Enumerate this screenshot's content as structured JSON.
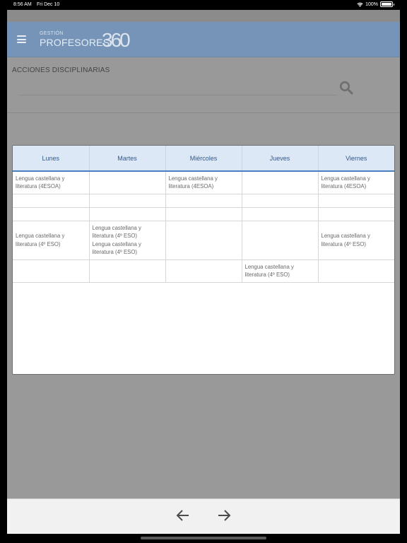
{
  "status_bar": {
    "time": "8:56 AM",
    "date": "Fri Dec 10",
    "battery": "100%",
    "battery_level": 1.0
  },
  "header": {
    "logo_small": "GESTIÓN",
    "logo_main": "PROFESORES",
    "logo_number": "360",
    "menu_icon": "hamburger-menu-icon",
    "color": "#7594b8"
  },
  "section": {
    "title": "ACCIONES DISCIPLINARIAS",
    "search_value": "",
    "search_placeholder": "",
    "search_icon": "search-icon"
  },
  "schedule": {
    "headers": [
      "Lunes",
      "Martes",
      "Miércoles",
      "Jueves",
      "Viernes"
    ],
    "rows": [
      [
        [
          "Lengua castellana y literatura (4ESOA)"
        ],
        [],
        [
          "Lengua castellana y literatura (4ESOA)"
        ],
        [],
        [
          "Lengua castellana y literatura (4ESOA)"
        ]
      ],
      [
        [],
        [],
        [],
        [],
        []
      ],
      [
        [],
        [],
        [],
        [],
        []
      ],
      [
        [
          "Lengua castellana y literatura (4º ESO)"
        ],
        [
          "Lengua castellana y literatura (4º ESO)",
          "Lengua castellana y literatura (4º ESO)"
        ],
        [],
        [],
        [
          "Lengua castellana y literatura (4º ESO)"
        ]
      ],
      [
        [],
        [],
        [],
        [
          "Lengua castellana y literatura (4º ESO)"
        ],
        []
      ]
    ],
    "header_bg": "#dce8f5",
    "header_text_color": "#34598a",
    "accent": "#4a7fc1"
  },
  "bottom_nav": {
    "back_icon": "arrow-left-icon",
    "forward_icon": "arrow-right-icon"
  }
}
